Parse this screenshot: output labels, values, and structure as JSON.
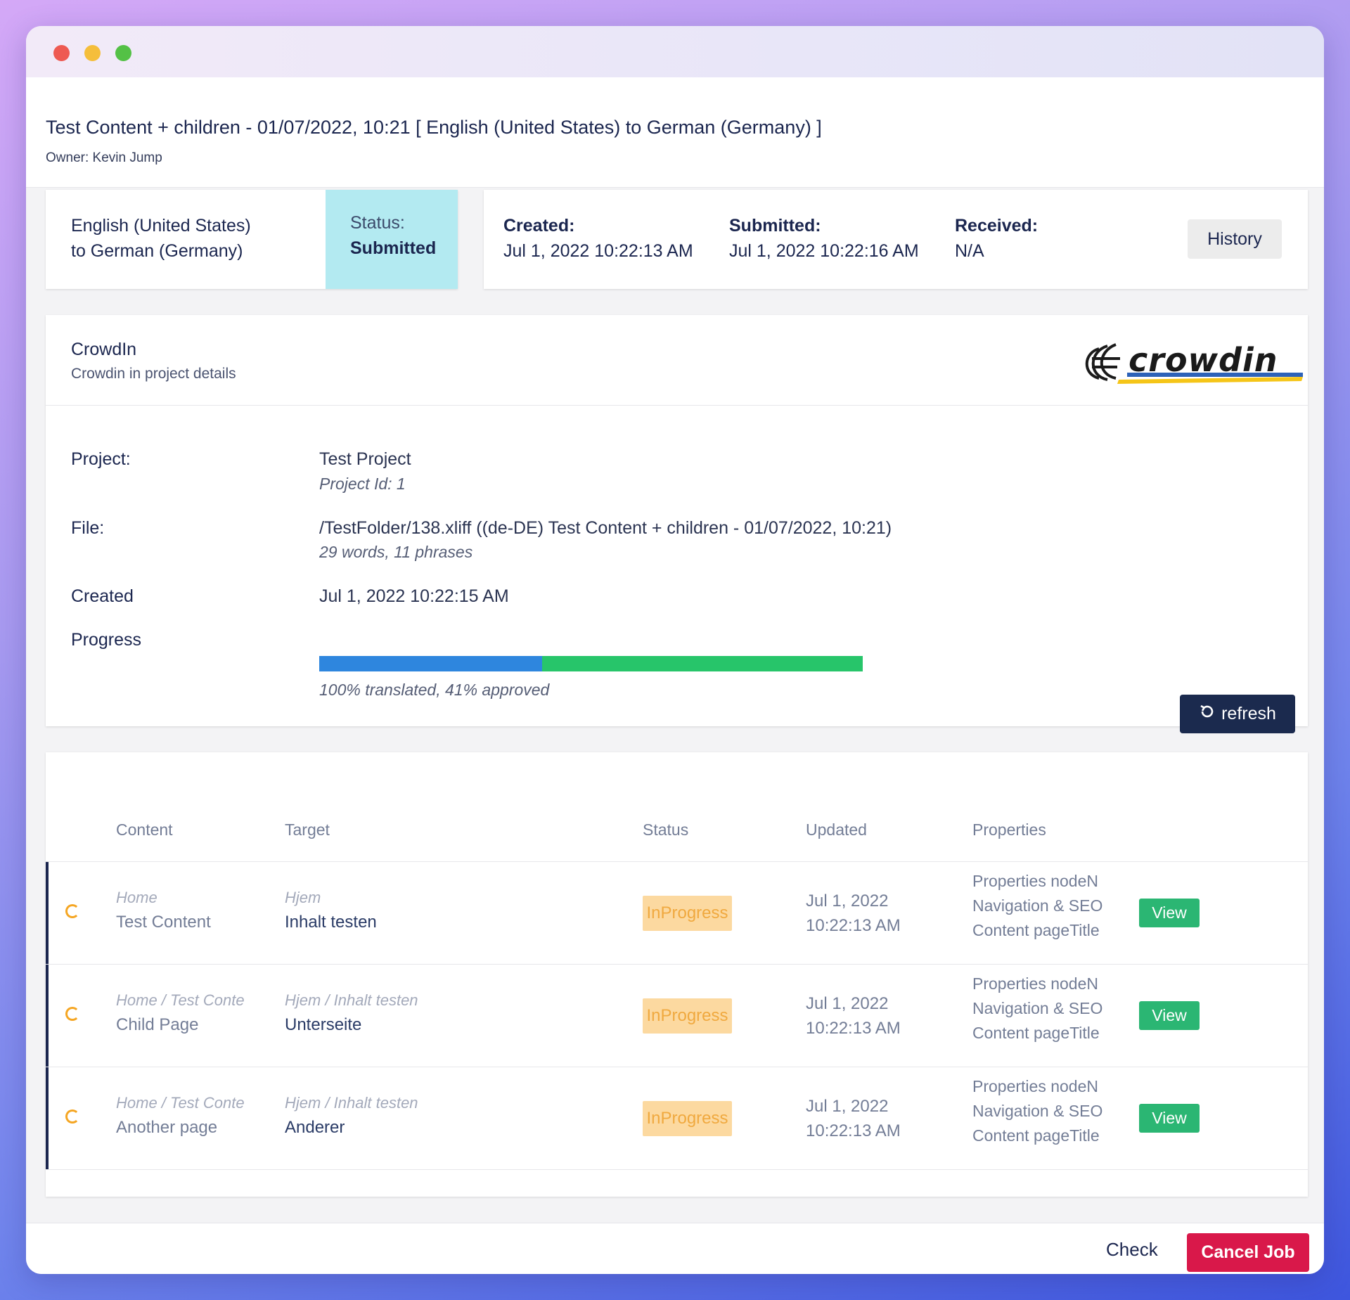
{
  "window": {
    "controls": [
      "close",
      "minimize",
      "maximize"
    ]
  },
  "header": {
    "title": "Test Content + children - 01/07/2022, 10:21 [ English (United States) to German (Germany) ]",
    "owner": "Owner: Kevin Jump"
  },
  "summary": {
    "language_line1": "English (United States)",
    "language_line2": "to German (Germany)",
    "status_label": "Status:",
    "status_value": "Submitted",
    "created_label": "Created:",
    "created_value": "Jul 1, 2022 10:22:13 AM",
    "submitted_label": "Submitted:",
    "submitted_value": "Jul 1, 2022 10:22:16 AM",
    "received_label": "Received:",
    "received_value": "N/A",
    "history_label": "History"
  },
  "crowdin": {
    "title": "CrowdIn",
    "subtitle": "Crowdin in project details",
    "logo_text": "crowdin",
    "project_label": "Project:",
    "project_value": "Test Project",
    "project_id": "Project Id: 1",
    "file_label": "File:",
    "file_value": "/TestFolder/138.xliff ((de-DE) Test Content + children - 01/07/2022, 10:21)",
    "file_stats": "29 words, 11 phrases",
    "created_label": "Created",
    "created_value": "Jul 1, 2022 10:22:15 AM",
    "progress_label": "Progress",
    "progress_translated": 1.0,
    "progress_approved": 0.41,
    "progress_text": "100% translated, 41% approved",
    "refresh_label": "refresh",
    "colors": {
      "approved": "#2e86de",
      "translated": "#27c56a"
    }
  },
  "table": {
    "headers": {
      "content": "Content",
      "target": "Target",
      "status": "Status",
      "updated": "Updated",
      "properties": "Properties"
    },
    "rows": [
      {
        "content_path": "Home",
        "content_name": "Test Content",
        "target_path": "Hjem",
        "target_name": "Inhalt testen",
        "status": "InProgress",
        "updated_date": "Jul 1, 2022",
        "updated_time": "10:22:13 AM",
        "properties": [
          "Properties nodeN",
          "Navigation & SEO",
          "Content pageTitle"
        ],
        "view_label": "View"
      },
      {
        "content_path": "Home / Test Conte",
        "content_name": "Child Page",
        "target_path": "Hjem / Inhalt testen",
        "target_name": "Unterseite",
        "status": "InProgress",
        "updated_date": "Jul 1, 2022",
        "updated_time": "10:22:13 AM",
        "properties": [
          "Properties nodeN",
          "Navigation & SEO",
          "Content pageTitle"
        ],
        "view_label": "View"
      },
      {
        "content_path": "Home / Test Conte",
        "content_name": "Another page",
        "target_path": "Hjem / Inhalt testen",
        "target_name": "Anderer",
        "status": "InProgress",
        "updated_date": "Jul 1, 2022",
        "updated_time": "10:22:13 AM",
        "properties": [
          "Properties nodeN",
          "Navigation & SEO",
          "Content pageTitle"
        ],
        "view_label": "View"
      }
    ]
  },
  "footer": {
    "check_label": "Check",
    "cancel_label": "Cancel Job"
  }
}
